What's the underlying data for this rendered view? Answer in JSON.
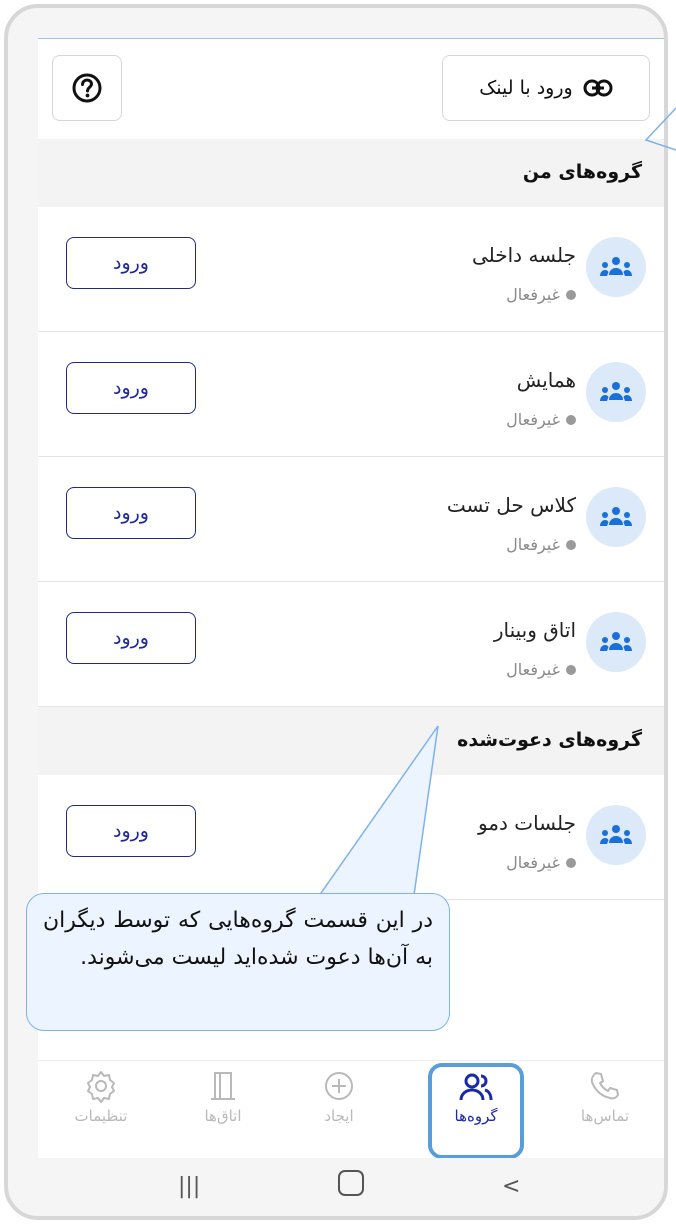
{
  "topbar": {
    "link_button_label": "ورود با لینک",
    "help_icon": "help-circle-icon",
    "link_icon": "link-icon"
  },
  "sections": {
    "my_groups_title": "گروه‌های من",
    "invited_groups_title": "گروه‌های دعوت‌شده"
  },
  "my_groups": [
    {
      "title": "جلسه داخلی",
      "status": "غیرفعال",
      "button": "ورود"
    },
    {
      "title": "همایش",
      "status": "غیرفعال",
      "button": "ورود"
    },
    {
      "title": "کلاس حل تست",
      "status": "غیرفعال",
      "button": "ورود"
    },
    {
      "title": "اتاق وبینار",
      "status": "غیرفعال",
      "button": "ورود"
    }
  ],
  "invited_groups": [
    {
      "title": "جلسات دمو",
      "status": "غیرفعال",
      "button": "ورود"
    }
  ],
  "tooltip": {
    "text": "در این قسمت گروه‌هایی که توسط دیگران به آن‌ها دعوت شده‌اید لیست می‌شوند."
  },
  "nav": {
    "settings": "تنظیمات",
    "rooms": "اتاق‌ها",
    "create": "ایجاد",
    "groups": "گروه‌ها",
    "contacts": "تماس‌ها"
  },
  "colors": {
    "accent": "#1a2aa8",
    "avatar_bg": "#dbe9f9",
    "active_outline": "#5a9ddb",
    "tooltip_bg": "#ecf5ff"
  }
}
